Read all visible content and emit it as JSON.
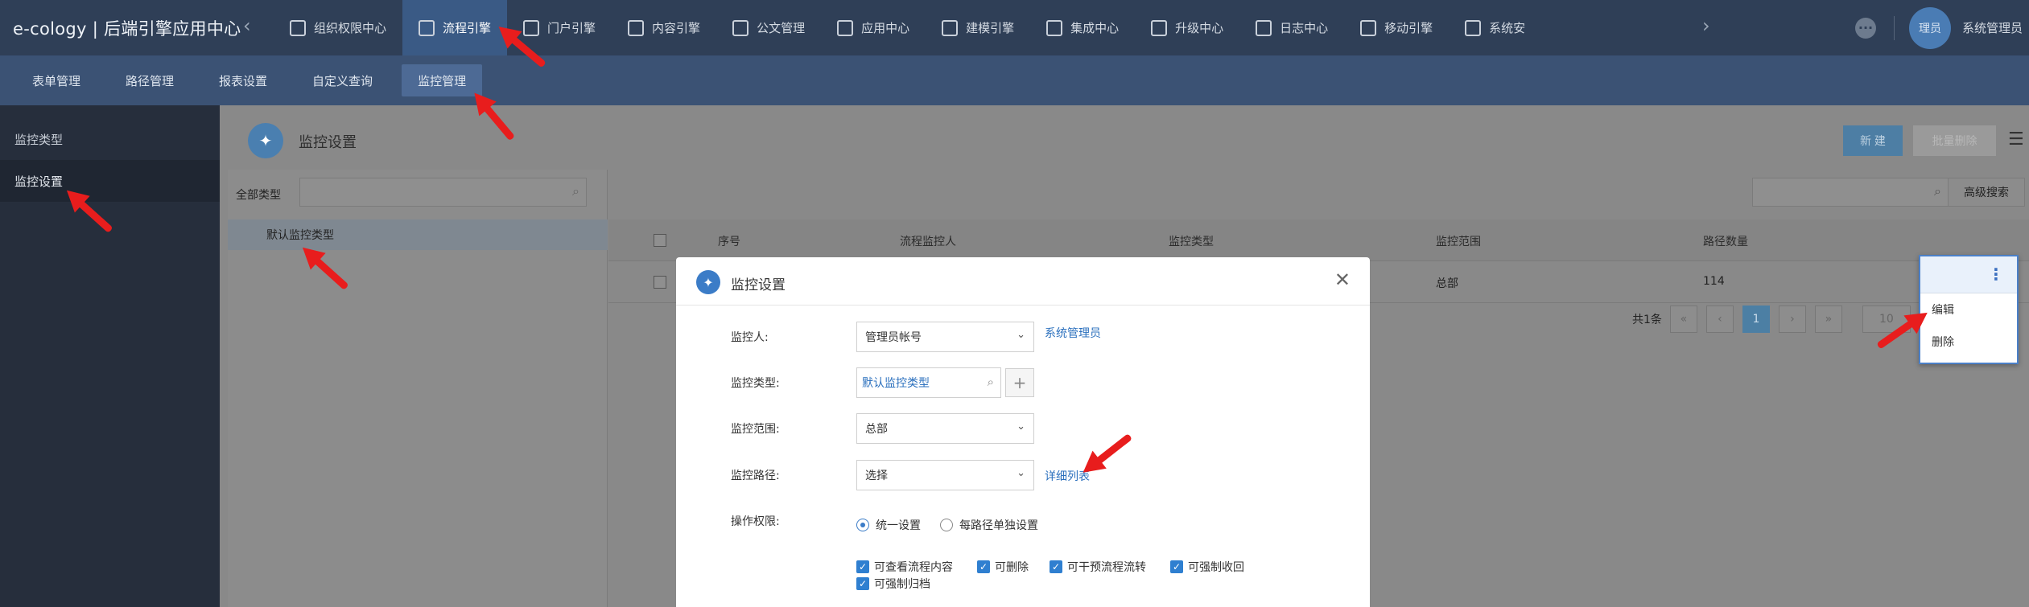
{
  "app": {
    "title": "e-cology | 后端引擎应用中心"
  },
  "top_nav": {
    "items": [
      {
        "label": "组织权限中心",
        "icon": "shield-icon"
      },
      {
        "label": "流程引擎",
        "icon": "workflow-icon",
        "active": true
      },
      {
        "label": "门户引擎",
        "icon": "portal-icon"
      },
      {
        "label": "内容引擎",
        "icon": "document-icon"
      },
      {
        "label": "公文管理",
        "icon": "doc-manage-icon"
      },
      {
        "label": "应用中心",
        "icon": "apps-icon"
      },
      {
        "label": "建模引擎",
        "icon": "cube-icon"
      },
      {
        "label": "集成中心",
        "icon": "integration-icon"
      },
      {
        "label": "升级中心",
        "icon": "upgrade-icon"
      },
      {
        "label": "日志中心",
        "icon": "log-icon"
      },
      {
        "label": "移动引擎",
        "icon": "mobile-icon"
      },
      {
        "label": "系统安",
        "icon": "system-icon"
      }
    ],
    "avatar_text": "理员",
    "user_name": "系统管理员"
  },
  "sub_nav": {
    "items": [
      "表单管理",
      "路径管理",
      "报表设置",
      "自定义查询",
      "监控管理"
    ],
    "active_index": 4
  },
  "sidebar": {
    "items": [
      "监控类型",
      "监控设置"
    ],
    "active_index": 1
  },
  "page": {
    "title": "监控设置",
    "new_button": "新 建",
    "batch_delete_button": "批量删除"
  },
  "tree": {
    "label": "全部类型",
    "search_placeholder": "",
    "node": "默认监控类型"
  },
  "table": {
    "adv_search_label": "高级搜索",
    "columns": [
      "序号",
      "流程监控人",
      "监控类型",
      "监控范围",
      "路径数量"
    ],
    "rows": [
      {
        "range": "总部",
        "count": "114"
      }
    ],
    "pager": {
      "total": "共1条",
      "current": "1",
      "page_size": "10"
    }
  },
  "row_menu": {
    "items": [
      "编辑",
      "删除"
    ]
  },
  "modal": {
    "title": "监控设置",
    "fields": {
      "monitor_person_label": "监控人:",
      "monitor_person_value": "管理员帐号",
      "monitor_person_link": "系统管理员",
      "monitor_type_label": "监控类型:",
      "monitor_type_value": "默认监控类型",
      "monitor_range_label": "监控范围:",
      "monitor_range_value": "总部",
      "monitor_path_label": "监控路径:",
      "monitor_path_value": "选择",
      "detail_link": "详细列表",
      "permission_label": "操作权限:"
    },
    "radios": [
      "统一设置",
      "每路径单独设置"
    ],
    "checkboxes": [
      "可查看流程内容",
      "可删除",
      "可干预流程流转",
      "可强制收回",
      "可强制归档"
    ]
  },
  "colors": {
    "annotation_arrow": "#e81d1d",
    "accent": "#3b7cc7",
    "topbar": "#2f3f57"
  }
}
